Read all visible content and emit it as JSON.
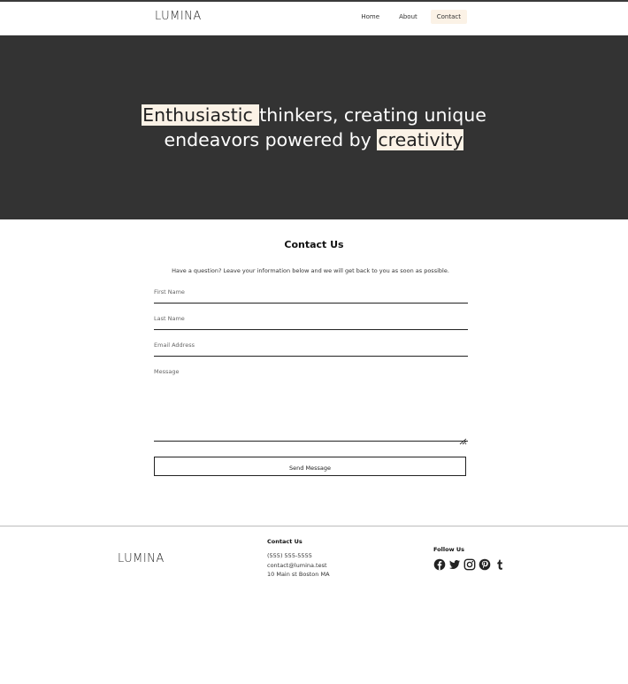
{
  "brand": {
    "logo": "LUMINA"
  },
  "nav": {
    "items": [
      {
        "label": "Home"
      },
      {
        "label": "About"
      },
      {
        "label": "Contact"
      }
    ]
  },
  "hero": {
    "highlight1": "Enthusiastic ",
    "text1": " thinkers, creating unique",
    "text2": "endeavors powered by ",
    "highlight2": "creativity"
  },
  "contact": {
    "title": "Contact Us",
    "intro": "Have a question? Leave your information below and we will get back to you as soon as possible.",
    "fields": {
      "first_name": "First Name",
      "last_name": "Last Name",
      "email": "Email Address",
      "message": "Message"
    },
    "submit_label": "Send Message"
  },
  "footer": {
    "logo": "LUMINA",
    "contact_title": "Contact Us",
    "phone": "(555) 555-5555",
    "email": "contact@lumina.test",
    "address": "10 Main st Boston MA",
    "follow_title": "Follow Us",
    "socials": [
      "facebook-icon",
      "twitter-icon",
      "instagram-icon",
      "pinterest-icon",
      "tumblr-icon"
    ]
  },
  "colors": {
    "accent": "#fbf2e6",
    "hero_bg": "#333333",
    "text": "#1f1f1f"
  }
}
